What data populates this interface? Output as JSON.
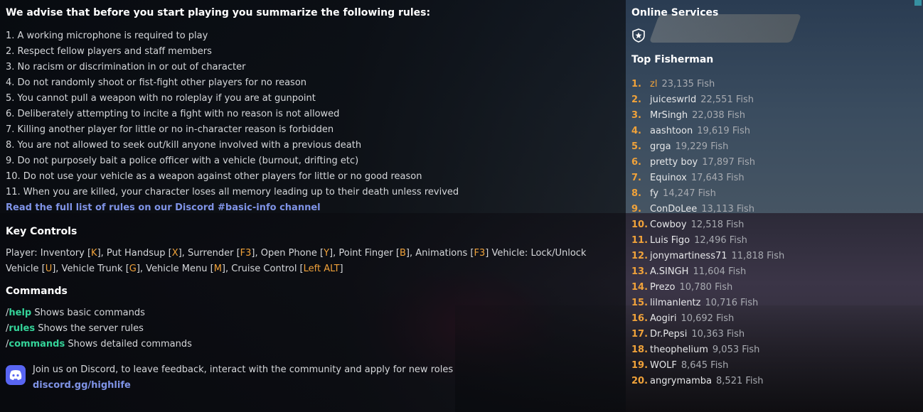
{
  "rules_section": {
    "title": "We advise that before you start playing you summarize the following rules:",
    "items": [
      "1. A working microphone is required to play",
      "2. Respect fellow players and staff members",
      "3. No racism or discrimination in or out of character",
      "4. Do not randomly shoot or fist-fight other players for no reason",
      "5. You cannot pull a weapon with no roleplay if you are at gunpoint",
      "6. Deliberately attempting to incite a fight with no reason is not allowed",
      "7. Killing another player for little or no in-character reason is forbidden",
      "8. You are not allowed to seek out/kill anyone involved with a previous death",
      "9. Do not purposely bait a police officer with a vehicle (burnout, drifting etc)",
      "10. Do not use your vehicle as a weapon against other players for little or no good reason",
      "11. When you are killed, your character loses all memory leading up to their death unless revived"
    ],
    "link": "Read the full list of rules on our Discord #basic-info channel"
  },
  "key_controls": {
    "title": "Key Controls",
    "parts": [
      {
        "text": "Player: Inventory ["
      },
      {
        "key": "K"
      },
      {
        "text": "], Put Handsup ["
      },
      {
        "key": "X"
      },
      {
        "text": "], Surrender ["
      },
      {
        "key": "F3"
      },
      {
        "text": "], Open Phone ["
      },
      {
        "key": "Y"
      },
      {
        "text": "], Point Finger ["
      },
      {
        "key": "B"
      },
      {
        "text": "], Animations ["
      },
      {
        "key": "F3"
      },
      {
        "text": "] Vehicle: Lock/Unlock Vehicle ["
      },
      {
        "key": "U"
      },
      {
        "text": "], Vehicle Trunk ["
      },
      {
        "key": "G"
      },
      {
        "text": "], Vehicle Menu ["
      },
      {
        "key": "M"
      },
      {
        "text": "], Cruise Control ["
      },
      {
        "key": "Left ALT"
      },
      {
        "text": "]"
      }
    ]
  },
  "commands": {
    "title": "Commands",
    "items": [
      {
        "slash": "/",
        "name": "help",
        "desc": " Shows basic commands"
      },
      {
        "slash": "/",
        "name": "rules",
        "desc": " Shows the server rules"
      },
      {
        "slash": "/",
        "name": "commands",
        "desc": " Shows detailed commands"
      }
    ]
  },
  "discord": {
    "icon": "discord-icon",
    "text": "Join us on Discord, to leave feedback, interact with the community and apply for new roles",
    "link": "discord.gg/highlife"
  },
  "online_services": {
    "title": "Online Services",
    "icon": "star-badge-icon"
  },
  "top_fisherman": {
    "title": "Top Fisherman",
    "entries": [
      {
        "rank": "1.",
        "name": "zl",
        "count": "23,135 Fish"
      },
      {
        "rank": "2.",
        "name": "juiceswrld",
        "count": "22,551 Fish"
      },
      {
        "rank": "3.",
        "name": "MrSingh",
        "count": "22,038 Fish"
      },
      {
        "rank": "4.",
        "name": "aashtoon",
        "count": "19,619 Fish"
      },
      {
        "rank": "5.",
        "name": "grga",
        "count": "19,229 Fish"
      },
      {
        "rank": "6.",
        "name": "pretty boy",
        "count": "17,897 Fish"
      },
      {
        "rank": "7.",
        "name": "Equinox",
        "count": "17,643 Fish"
      },
      {
        "rank": "8.",
        "name": "fy",
        "count": "14,247 Fish"
      },
      {
        "rank": "9.",
        "name": "ConDoLee",
        "count": "13,113 Fish"
      },
      {
        "rank": "10.",
        "name": "Cowboy",
        "count": "12,518 Fish"
      },
      {
        "rank": "11.",
        "name": "Luis Figo",
        "count": "12,496 Fish"
      },
      {
        "rank": "12.",
        "name": "jonymartiness71",
        "count": "11,818 Fish"
      },
      {
        "rank": "13.",
        "name": "A.SINGH",
        "count": "11,604 Fish"
      },
      {
        "rank": "14.",
        "name": "Prezo",
        "count": "10,780 Fish"
      },
      {
        "rank": "15.",
        "name": "lilmanlentz",
        "count": "10,716 Fish"
      },
      {
        "rank": "16.",
        "name": "Aogiri",
        "count": "10,692 Fish"
      },
      {
        "rank": "17.",
        "name": "Dr.Pepsi",
        "count": "10,363 Fish"
      },
      {
        "rank": "18.",
        "name": "theophelium",
        "count": "9,053 Fish"
      },
      {
        "rank": "19.",
        "name": "WOLF",
        "count": "8,645 Fish"
      },
      {
        "rank": "20.",
        "name": "angrymamba",
        "count": "8,521 Fish"
      }
    ]
  },
  "colors": {
    "key_accent": "#f0a23a",
    "command_accent": "#34d399",
    "link": "#7f93e6",
    "discord_brand": "#5865f2"
  }
}
